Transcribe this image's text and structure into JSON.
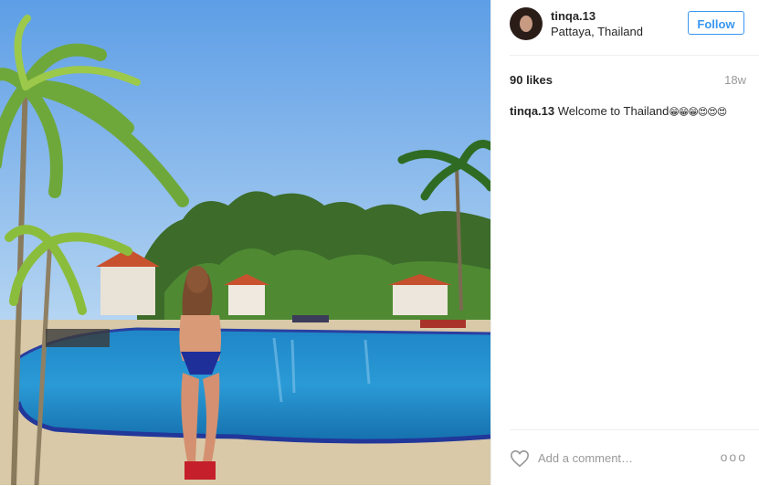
{
  "post": {
    "username": "tinqa.13",
    "location": "Pattaya, Thailand",
    "follow_label": "Follow",
    "likes": "90 likes",
    "age": "18w",
    "caption_user": "tinqa.13",
    "caption_text": "Welcome to Thailand",
    "caption_emoji": "😁😁😁😍😍😍",
    "comment_placeholder": "Add a comment…",
    "more_label": "ooo"
  },
  "colors": {
    "accent": "#3897f0",
    "muted": "#999999",
    "divider": "#efefef"
  },
  "icons": {
    "like": "heart-outline-icon",
    "more": "more-options-icon"
  }
}
